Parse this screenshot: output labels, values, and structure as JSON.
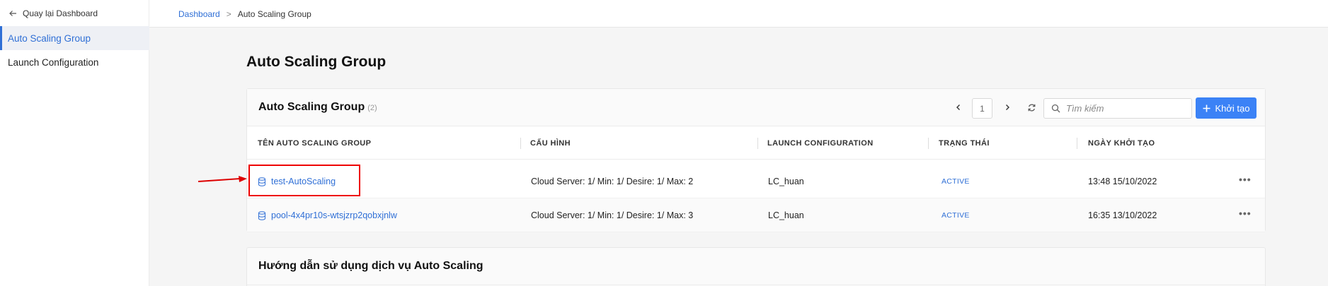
{
  "sidebar": {
    "back_label": "Quay lại Dashboard",
    "items": [
      {
        "label": "Auto Scaling Group",
        "active": true
      },
      {
        "label": "Launch Configuration",
        "active": false
      }
    ]
  },
  "breadcrumb": {
    "root": "Dashboard",
    "separator": ">",
    "current": "Auto Scaling Group"
  },
  "page_title": "Auto Scaling Group",
  "card": {
    "title": "Auto Scaling Group",
    "count": "(2)",
    "page": "1",
    "search_placeholder": "Tìm kiếm",
    "create_label": "Khởi tạo"
  },
  "table": {
    "headers": [
      "TÊN AUTO SCALING GROUP",
      "CẤU HÌNH",
      "LAUNCH CONFIGURATION",
      "TRẠNG THÁI",
      "NGÀY KHỞI TẠO"
    ],
    "rows": [
      {
        "name": "test-AutoScaling",
        "config": "Cloud Server: 1/ Min: 1/ Desire: 1/ Max: 2",
        "launch_config": "LC_huan",
        "status": "ACTIVE",
        "created": "13:48 15/10/2022",
        "more": "•••"
      },
      {
        "name": "pool-4x4pr10s-wtsjzrp2qobxjnlw",
        "config": "Cloud Server: 1/ Min: 1/ Desire: 1/ Max: 3",
        "launch_config": "LC_huan",
        "status": "ACTIVE",
        "created": "16:35 13/10/2022",
        "more": "•••"
      }
    ]
  },
  "guide": {
    "title": "Hướng dẫn sử dụng dịch vụ Auto Scaling"
  },
  "colors": {
    "accent": "#2f6fd6",
    "button": "#3b82f6",
    "highlight": "#e00000"
  },
  "icons": [
    "arrow-left-icon",
    "chevron-left-icon",
    "chevron-right-icon",
    "refresh-icon",
    "search-icon",
    "plus-icon",
    "database-icon",
    "more-icon",
    "annotation-arrow"
  ]
}
